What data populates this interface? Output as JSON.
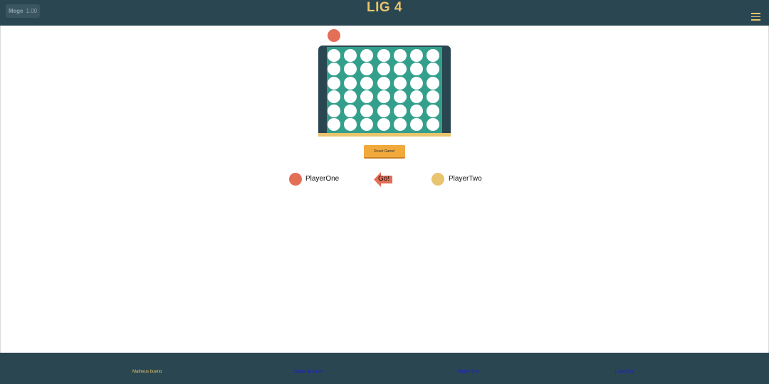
{
  "header": {
    "badge": {
      "name": "Mege",
      "version": "1.00"
    },
    "title": "LIG 4",
    "menu_icon": "hamburger-menu-icon"
  },
  "board": {
    "columns": 7,
    "rows": 6,
    "cells": [
      [
        "empty",
        "empty",
        "empty",
        "empty",
        "empty",
        "empty",
        "empty"
      ],
      [
        "empty",
        "empty",
        "empty",
        "empty",
        "empty",
        "empty",
        "empty"
      ],
      [
        "empty",
        "empty",
        "empty",
        "empty",
        "empty",
        "empty",
        "empty"
      ],
      [
        "empty",
        "empty",
        "empty",
        "empty",
        "empty",
        "empty",
        "empty"
      ],
      [
        "empty",
        "empty",
        "empty",
        "empty",
        "empty",
        "empty",
        "empty"
      ],
      [
        "empty",
        "empty",
        "empty",
        "empty",
        "empty",
        "empty",
        "empty"
      ]
    ],
    "hover_column": 1,
    "hover_color": "#e36f57"
  },
  "controls": {
    "reset_label": "Reset Game!"
  },
  "players": {
    "one": {
      "name": "PlayerOne",
      "color": "#e36f57"
    },
    "two": {
      "name": "PlayerTwo",
      "color": "#e8c46e"
    },
    "turn_label": "Go!",
    "turn_arrow_direction": "left",
    "turn_arrow_color": "#e36f57"
  },
  "footer": {
    "items": [
      {
        "label": "Matheus bueno",
        "is_link": false
      },
      {
        "label": "Sobre dev bom",
        "is_link": true
      },
      {
        "label": "Weber Dev",
        "is_link": true
      },
      {
        "label": "Linke Dev",
        "is_link": true
      }
    ]
  },
  "colors": {
    "navbar": "#2a4651",
    "accent": "#e8c46e",
    "board_frame": "#2a4651",
    "board_face": "#34a08c",
    "button": "#f2a93b"
  }
}
